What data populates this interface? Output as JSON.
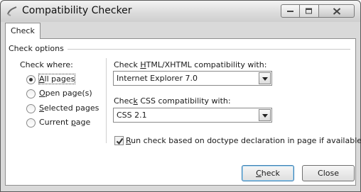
{
  "window": {
    "title": "Compatibility Checker"
  },
  "tabs": [
    {
      "label": "Check"
    }
  ],
  "group": {
    "legend": "Check options"
  },
  "check_where": {
    "label": "Check where:",
    "options": [
      {
        "pre": "",
        "u": "A",
        "post": "ll pages",
        "selected": true
      },
      {
        "pre": "",
        "u": "O",
        "post": "pen page(s)",
        "selected": false
      },
      {
        "pre": "",
        "u": "S",
        "post": "elected pages",
        "selected": false
      },
      {
        "pre": "Current ",
        "u": "p",
        "post": "age",
        "selected": false
      }
    ]
  },
  "html_compat": {
    "label_pre": "Check ",
    "label_u": "H",
    "label_post": "TML/XHTML compatibility with:",
    "value": "Internet Explorer 7.0"
  },
  "css_compat": {
    "label_pre": "Chec",
    "label_u": "k",
    "label_post": " CSS compatibility with:",
    "value": "CSS 2.1"
  },
  "doctype_check": {
    "checked": true,
    "label_pre": "",
    "label_u": "R",
    "label_post": "un check based on doctype declaration in page if available"
  },
  "buttons": {
    "check": {
      "pre": "",
      "u": "C",
      "post": "heck"
    },
    "close": {
      "label": "Close"
    }
  },
  "icons": {
    "app": "compatibility-app-icon",
    "minimize": "minimize-icon",
    "maximize": "maximize-icon",
    "close": "close-icon",
    "dropdown": "chevron-down-icon",
    "checkmark": "checkmark-icon"
  }
}
